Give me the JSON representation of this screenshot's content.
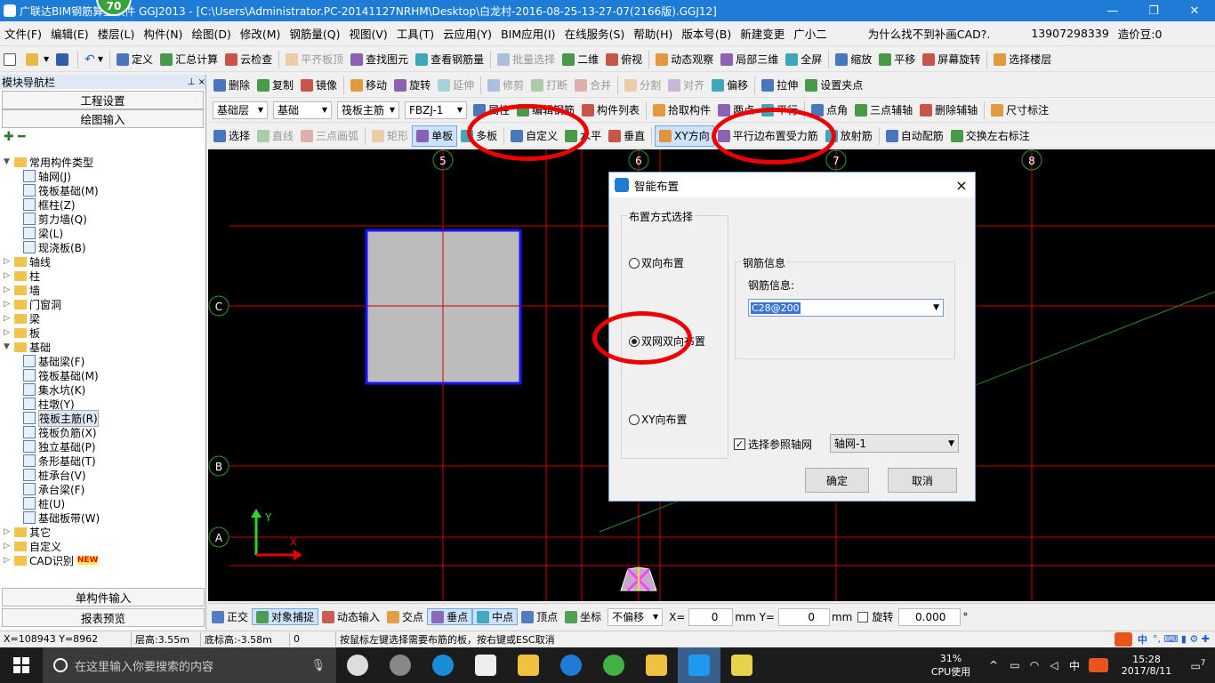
{
  "window": {
    "title": "广联达BIM钢筋算量软件 GGJ2013 - [C:\\Users\\Administrator.PC-20141127NRHM\\Desktop\\白龙村-2016-08-25-13-27-07(2166版).GGJ12]",
    "badge": "70"
  },
  "menu": {
    "items": [
      "文件(F)",
      "编辑(E)",
      "楼层(L)",
      "构件(N)",
      "绘图(D)",
      "修改(M)",
      "钢筋量(Q)",
      "视图(V)",
      "工具(T)",
      "云应用(Y)",
      "BIM应用(I)",
      "在线服务(S)",
      "帮助(H)",
      "版本号(B)"
    ],
    "new_change": "新建变更",
    "assistant": "广小二",
    "question": "为什么找不到补画CAD?.",
    "phone": "13907298339",
    "beans": "造价豆:0"
  },
  "toolbar1": {
    "items": [
      "定义",
      "汇总计算",
      "云检查",
      "平齐板顶",
      "查找图元",
      "查看钢筋量",
      "批量选择",
      "二维",
      "俯视",
      "动态观察",
      "局部三维",
      "全屏",
      "缩放",
      "平移",
      "屏幕旋转",
      "选择楼层"
    ]
  },
  "toolbar2": {
    "items": [
      "删除",
      "复制",
      "镜像",
      "移动",
      "旋转",
      "延伸",
      "修剪",
      "打断",
      "合并",
      "分割",
      "对齐",
      "偏移",
      "拉伸",
      "设置夹点"
    ]
  },
  "toolbar3": {
    "floor": "基础层",
    "layer": "基础",
    "type": "筏板主筋",
    "name": "FBZJ-1",
    "items": [
      "属性",
      "编辑钢筋",
      "构件列表",
      "拾取构件",
      "两点",
      "平行",
      "点角",
      "三点辅轴",
      "删除辅轴",
      "尺寸标注"
    ]
  },
  "toolbar4": {
    "items": [
      "选择",
      "直线",
      "三点画弧",
      "矩形",
      "单板",
      "多板",
      "自定义",
      "水平",
      "垂直",
      "XY方向",
      "平行边布置受力筋",
      "放射筋",
      "自动配筋",
      "交换左右标注"
    ]
  },
  "leftpanel": {
    "title": "模块导航栏",
    "btn_setup": "工程设置",
    "btn_draw": "绘图输入",
    "btn_single": "单构件输入",
    "btn_report": "报表预览",
    "tree": [
      {
        "label": "常用构件类型",
        "level": 0,
        "expanded": true,
        "folder": true
      },
      {
        "label": "轴网(J)",
        "level": 1,
        "icon": "axis-grid-icon"
      },
      {
        "label": "筏板基础(M)",
        "level": 1,
        "icon": "raft-foundation-icon"
      },
      {
        "label": "框柱(Z)",
        "level": 1,
        "icon": "frame-column-icon"
      },
      {
        "label": "剪力墙(Q)",
        "level": 1,
        "icon": "shear-wall-icon"
      },
      {
        "label": "梁(L)",
        "level": 1,
        "icon": "beam-icon"
      },
      {
        "label": "现浇板(B)",
        "level": 1,
        "icon": "slab-icon"
      },
      {
        "label": "轴线",
        "level": 0,
        "folder": true
      },
      {
        "label": "柱",
        "level": 0,
        "folder": true
      },
      {
        "label": "墙",
        "level": 0,
        "folder": true
      },
      {
        "label": "门窗洞",
        "level": 0,
        "folder": true
      },
      {
        "label": "梁",
        "level": 0,
        "folder": true
      },
      {
        "label": "板",
        "level": 0,
        "folder": true
      },
      {
        "label": "基础",
        "level": 0,
        "expanded": true,
        "folder": true
      },
      {
        "label": "基础梁(F)",
        "level": 1,
        "icon": "foundation-beam-icon"
      },
      {
        "label": "筏板基础(M)",
        "level": 1,
        "icon": "raft-foundation-icon"
      },
      {
        "label": "集水坑(K)",
        "level": 1,
        "icon": "sump-pit-icon"
      },
      {
        "label": "柱墩(Y)",
        "level": 1,
        "icon": "column-pier-icon"
      },
      {
        "label": "筏板主筋(R)",
        "level": 1,
        "icon": "raft-main-rebar-icon",
        "selected": true
      },
      {
        "label": "筏板负筋(X)",
        "level": 1,
        "icon": "raft-negative-rebar-icon"
      },
      {
        "label": "独立基础(P)",
        "level": 1,
        "icon": "isolated-foundation-icon"
      },
      {
        "label": "条形基础(T)",
        "level": 1,
        "icon": "strip-foundation-icon"
      },
      {
        "label": "桩承台(V)",
        "level": 1,
        "icon": "pile-cap-icon"
      },
      {
        "label": "承台梁(F)",
        "level": 1,
        "icon": "cap-beam-icon"
      },
      {
        "label": "桩(U)",
        "level": 1,
        "icon": "pile-icon"
      },
      {
        "label": "基础板带(W)",
        "level": 1,
        "icon": "foundation-strip-icon"
      },
      {
        "label": "其它",
        "level": 0,
        "folder": true
      },
      {
        "label": "自定义",
        "level": 0,
        "folder": true
      },
      {
        "label": "CAD识别",
        "level": 0,
        "folder": true,
        "new": "NEW"
      }
    ]
  },
  "canvas": {
    "axis_labels": [
      "5",
      "6",
      "7",
      "8",
      "C",
      "B",
      "A"
    ],
    "y_axis": "Y",
    "x_axis": "X"
  },
  "dialog": {
    "title": "智能布置",
    "group_layout": "布置方式选择",
    "opt1": "双向布置",
    "opt2": "双网双向布置",
    "opt3": "XY向布置",
    "selected": "双网双向布置",
    "group_rebar": "钢筋信息",
    "rebar_label": "钢筋信息:",
    "rebar_value": "C28@200",
    "ref_axis_label": "选择参照轴网",
    "ref_axis_checked": true,
    "ref_axis_value": "轴网-1",
    "ok": "确定",
    "cancel": "取消"
  },
  "statusbar": {
    "items": [
      "正交",
      "对象捕捉",
      "动态输入",
      "交点",
      "垂点",
      "中点",
      "顶点",
      "坐标"
    ],
    "offset": "不偏移",
    "x_label": "X=",
    "x_value": "0",
    "y_label": "mm Y=",
    "y_value": "0",
    "mm": "mm",
    "rotate": "旋转",
    "rotate_value": "0.000",
    "deg": "°"
  },
  "coord": {
    "xy": "X=108943 Y=8962",
    "floor_h": "层高:3.55m",
    "bottom_h": "底标高:-3.58m",
    "zero": "0",
    "hint": "按鼠标左键选择需要布筋的板，按右键或ESC取消"
  },
  "taskbar": {
    "search": "在这里输入你要搜索的内容",
    "cpu_pct": "31%",
    "cpu_label": "CPU使用",
    "ime": "中",
    "time": "15:28",
    "date": "2017/8/11",
    "notif": "7"
  },
  "colors": {
    "title_bg": "#1e7bd6",
    "canvas_bg": "#000000",
    "axis_red": "#e00000",
    "slab_gray": "#bcbcbc",
    "slab_border": "#1515ff",
    "annotation_red": "#ee0000"
  }
}
